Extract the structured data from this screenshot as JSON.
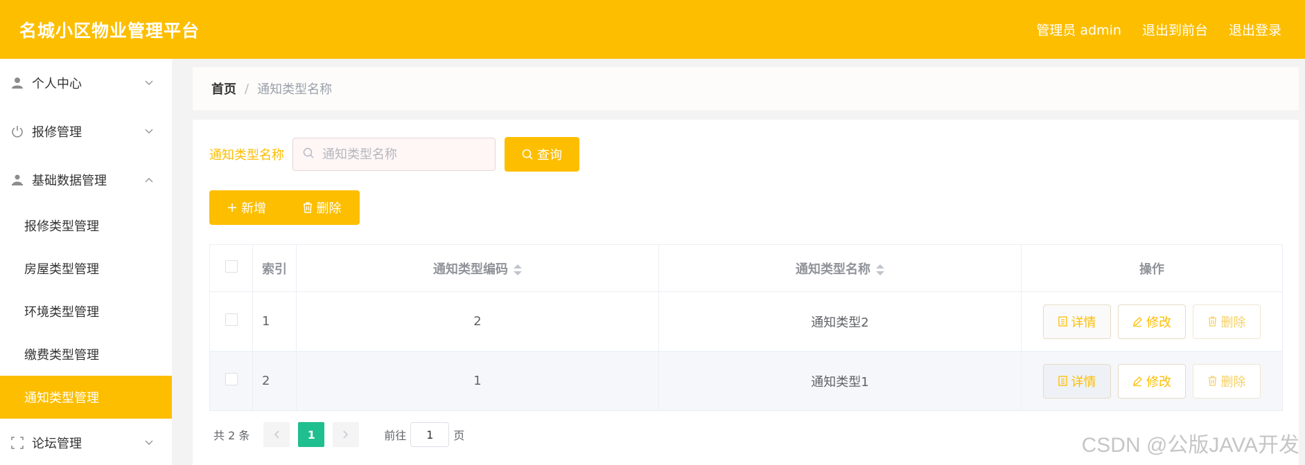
{
  "header": {
    "title": "名城小区物业管理平台",
    "user_label": "管理员 admin",
    "exit_front": "退出到前台",
    "logout": "退出登录"
  },
  "sidebar": {
    "groups": [
      {
        "label": "个人中心",
        "icon": "user-icon",
        "expanded": false
      },
      {
        "label": "报修管理",
        "icon": "power-icon",
        "expanded": false
      },
      {
        "label": "基础数据管理",
        "icon": "user-alt-icon",
        "expanded": true
      },
      {
        "label": "论坛管理",
        "icon": "frame-icon",
        "expanded": false
      }
    ],
    "sub_items": [
      {
        "label": "报修类型管理"
      },
      {
        "label": "房屋类型管理"
      },
      {
        "label": "环境类型管理"
      },
      {
        "label": "缴费类型管理"
      },
      {
        "label": "通知类型管理",
        "active": true
      }
    ]
  },
  "breadcrumb": {
    "home": "首页",
    "separator": "/",
    "current": "通知类型名称"
  },
  "search": {
    "label": "通知类型名称",
    "placeholder": "通知类型名称",
    "value": "",
    "button": "查询"
  },
  "actions": {
    "add": "新增",
    "delete": "删除"
  },
  "table": {
    "headers": {
      "index": "索引",
      "code": "通知类型编码",
      "name": "通知类型名称",
      "ops": "操作"
    },
    "rows": [
      {
        "index": "1",
        "code": "2",
        "name": "通知类型2"
      },
      {
        "index": "2",
        "code": "1",
        "name": "通知类型1"
      }
    ],
    "row_ops": {
      "detail": "详情",
      "edit": "修改",
      "delete": "删除"
    }
  },
  "pagination": {
    "total": "共 2 条",
    "current_page": "1",
    "goto_prefix": "前往",
    "goto_value": "1",
    "goto_suffix": "页"
  },
  "watermark": "CSDN @公版JAVA开发",
  "colors": {
    "accent": "#fdbe00",
    "pager_active": "#1fbf8f"
  }
}
